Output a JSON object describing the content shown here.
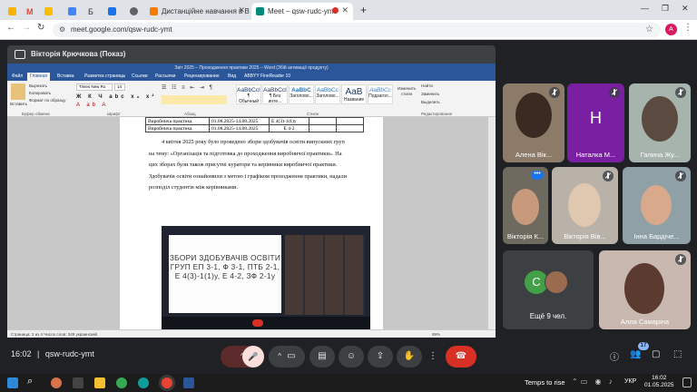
{
  "browser": {
    "tabs": [
      {
        "label": "",
        "color": "#f4b400"
      },
      {
        "label": "M",
        "color": "#ea4335"
      },
      {
        "label": "",
        "color": "#fbbc04"
      },
      {
        "label": "",
        "color": "#4285f4"
      },
      {
        "label": "Б",
        "color": "#5f6368"
      },
      {
        "label": "",
        "color": "#1a73e8"
      },
      {
        "label": "",
        "color": "#5f6368"
      },
      {
        "label": "Дистанційне навчання в ВСП",
        "color": "#f57c00"
      },
      {
        "label": "Meet – qsw-rudc-ymt",
        "color": "#00897b"
      }
    ],
    "new_tab": "+",
    "url": "meet.google.com/qsw-rudc-ymt",
    "profile_initial": "А"
  },
  "presenter": {
    "label": "Вікторія Крючкова (Показ)"
  },
  "word": {
    "title": "Звіт 2025 – Проходження практики 2025 – Word (Збій активації продукту)",
    "tabs": [
      "Файл",
      "Главная",
      "Вставка",
      "Разметка страницы",
      "Ссылки",
      "Рассылки",
      "Рецензирование",
      "Вид",
      "ABBYY FineReader 10"
    ],
    "font_name": "Times New Ro",
    "font_size": "14",
    "groups": [
      "Буфер обмена",
      "Шрифт",
      "Абзац",
      "Стили",
      "Редактирование"
    ],
    "clipboard": [
      "Вставить",
      "Вырезать",
      "Копировать",
      "Формат по образцу"
    ],
    "styles": [
      {
        "sample": "AaBbCcI",
        "name": "¶ Обычный"
      },
      {
        "sample": "AaBbCcI",
        "name": "¶ Без инте..."
      },
      {
        "sample": "AaBbC",
        "name": "Заголово..."
      },
      {
        "sample": "AaBbCc",
        "name": "Заголово..."
      },
      {
        "sample": "AaB",
        "name": "Название"
      },
      {
        "sample": "AaBbCc",
        "name": "Подзагол..."
      }
    ],
    "change_styles": "Изменить стили",
    "editing": [
      "Найти",
      "Заменить",
      "Выделить"
    ],
    "table_rows": [
      {
        "name": "Виробнича практика",
        "dates": "01.08.2025-14.08.2025",
        "group": "Е 4(3)-1(1)у"
      },
      {
        "name": "Виробнича практика",
        "dates": "01.08.2025-14.08.2025",
        "group": "Е 4-2"
      }
    ],
    "paragraph": [
      "4 квітня 2025 року було проведено збори здобувачів освіти випускних груп",
      "на тему: «Організація та підготовка до проходження виробничої практики». На",
      "цих зборах були також присутні куратори та керівники виробничої практики.",
      "Здобувачів освіти ознайомили з метою і графіком проходження практики, надали",
      "розподіл студентів між керівниками."
    ],
    "slide_lines": [
      "ЗБОРИ ЗДОБУВАЧІВ ОСВІТИ",
      "ГРУП ЕП 3-1, Ф 3-1, ПТБ 2-1,",
      "Е 4(3)-1(1)у, Е 4-2, ЗФ 2-1у"
    ],
    "status_bar": "Страница: 2 из 4    Число слов: 349    украинский",
    "zoom": "99%"
  },
  "participants": [
    {
      "name": "Алена Вік...",
      "bg": "#8d7b6a",
      "muted": true
    },
    {
      "name": "Наталка М...",
      "initial": "Н",
      "bg": "#7b1fa2",
      "muted": true
    },
    {
      "name": "Галина Жу...",
      "bg": "#a7b3ad",
      "muted": true
    },
    {
      "name": "Вікторія К...",
      "bg": "#6f6a60",
      "muted": false
    },
    {
      "name": "Вікторія Вів...",
      "bg": "#b9b2a8",
      "muted": true
    },
    {
      "name": "Інна Бардіче...",
      "bg": "#8fa0a6",
      "muted": true
    },
    {
      "name": "Ещё 9 чел.",
      "initial": "С",
      "bg": "#3c4043",
      "muted": false
    },
    {
      "name": "Алла Самаріна",
      "bg": "#c9b8b0",
      "muted": true
    }
  ],
  "meeting": {
    "time": "16:02",
    "code": "qsw-rudc-ymt",
    "participant_count": "17"
  },
  "taskbar": {
    "weather": "Temps to rise",
    "lang": "УКР",
    "time": "16:02",
    "date": "01.05.2025"
  }
}
